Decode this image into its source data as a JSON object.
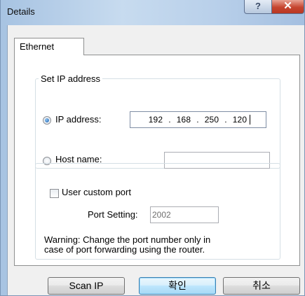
{
  "window": {
    "title": "Details",
    "help_label": "?",
    "close_label": "✕"
  },
  "tabs": [
    {
      "label": "Ethernet",
      "selected": true
    }
  ],
  "set_ip": {
    "legend": "Set IP address",
    "ip_option_label": "IP address:",
    "ip_option_selected": true,
    "ip_octets": [
      "192",
      "168",
      "250",
      "120"
    ],
    "ip_separator": ".",
    "host_option_label": "Host name:",
    "host_option_selected": false,
    "host_value": ""
  },
  "custom_port": {
    "checkbox_label": "User custom port",
    "checked": false,
    "port_setting_label": "Port Setting:",
    "port_value": "2002",
    "warning_line1": "Warning: Change the port number only in",
    "warning_line2": "case of port forwarding using the router."
  },
  "buttons": {
    "scan_ip": "Scan IP",
    "ok": "확인",
    "cancel": "취소"
  }
}
